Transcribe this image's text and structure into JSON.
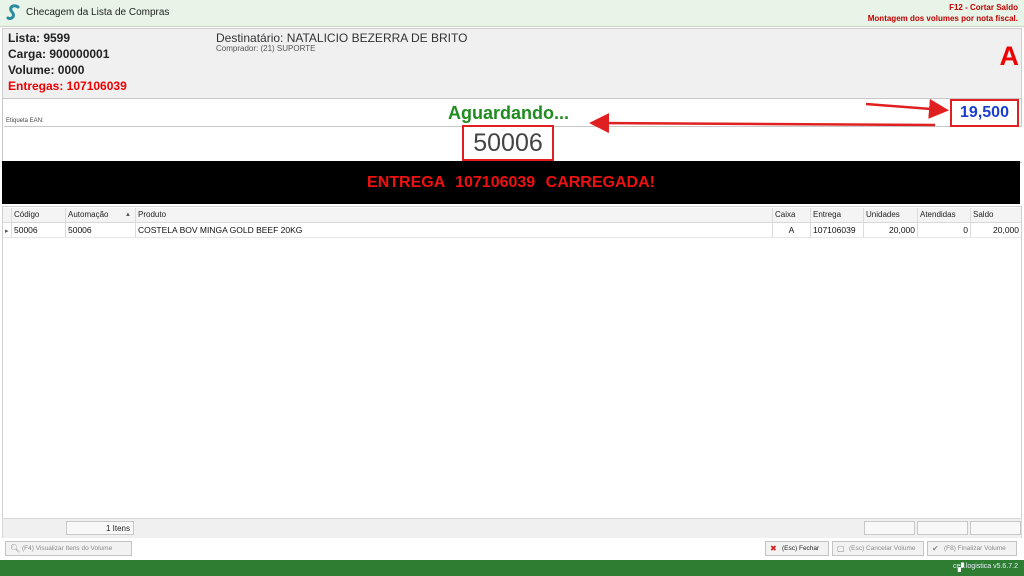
{
  "app": {
    "title": "Checagem da Lista de Compras",
    "hint_shortcut": "F12 - Cortar Saldo",
    "hint_mode": "Montagem dos volumes por nota fiscal."
  },
  "info": {
    "lista": "Lista: 9599",
    "carga": "Carga: 900000001",
    "volume": "Volume: 0000",
    "entregas": "Entregas: 107106039",
    "destinatario": "Destinatário: NATALICIO BEZERRA DE BRITO",
    "comprador": "Comprador: (21) SUPORTE",
    "box_letter": "A"
  },
  "ean": {
    "label": "Etiqueta EAN:",
    "status": "Aguardando...",
    "weight": "19,500",
    "value": "50006"
  },
  "banner": "ENTREGA  107106039  CARREGADA!",
  "grid": {
    "headers": [
      "Código",
      "Automação",
      "Produto",
      "Caixa",
      "Entrega",
      "Unidades",
      "Atendidas",
      "Saldo"
    ],
    "rows": [
      {
        "codigo": "50006",
        "automacao": "50006",
        "produto": "COSTELA BOV MINGA GOLD BEEF 20KG",
        "caixa": "A",
        "entrega": "107106039",
        "unidades": "20,000",
        "atendidas": "0",
        "saldo": "20,000"
      }
    ],
    "count": "1 Itens"
  },
  "buttons": {
    "visualizar": "(F4) Visualizar Itens do Volume",
    "fechar": "(Esc) Fechar",
    "cancelar": "(Esc) Cancelar Volume",
    "finalizar": "(F8) Finalizar Volume"
  },
  "version": "ces.logistica v5.6.7.2",
  "colors": {
    "title_bg": "#e8f4e8",
    "status_green": "#1e8c1e",
    "alert_red": "#ee0000",
    "weight_blue": "#1a3fd0",
    "statusbar_green": "#2e7d32"
  }
}
